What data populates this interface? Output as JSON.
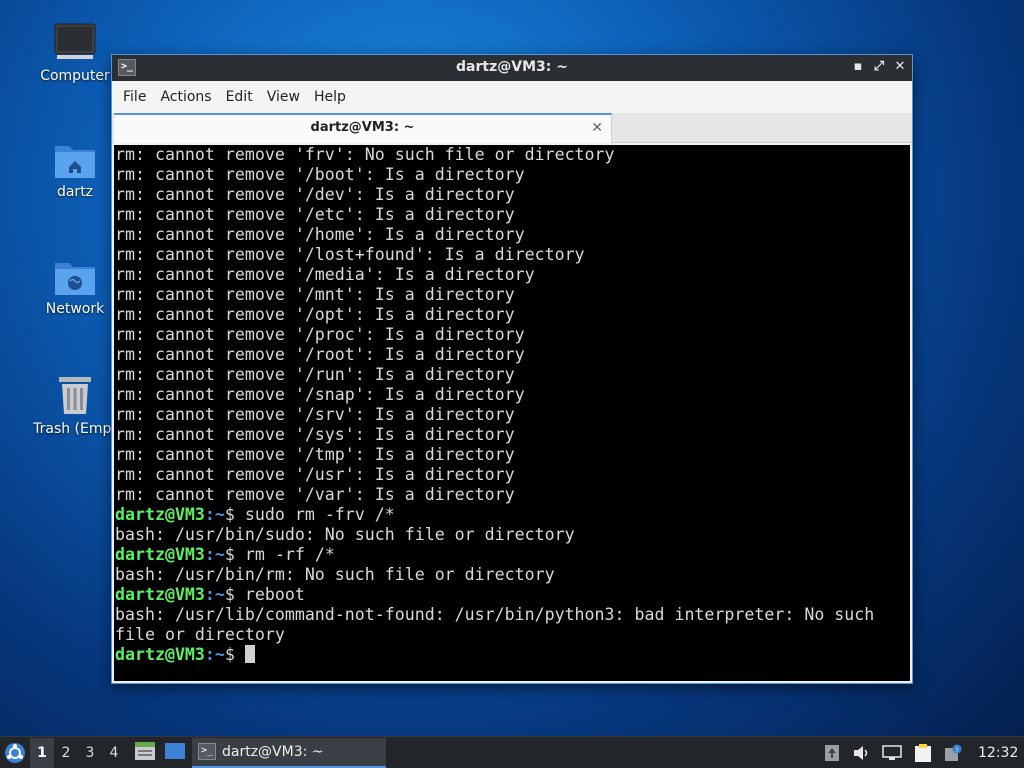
{
  "desktop": {
    "icons": [
      {
        "label": "Computer",
        "icon": "computer-icon"
      },
      {
        "label": "dartz",
        "icon": "home-folder-icon"
      },
      {
        "label": "Network",
        "icon": "network-folder-icon"
      },
      {
        "label": "Trash (Empt",
        "icon": "trash-icon"
      }
    ]
  },
  "window": {
    "title": "dartz@VM3: ~",
    "buttons": {
      "minimize": "▪",
      "maximize": "⤢",
      "close": "✕"
    },
    "menu": [
      "File",
      "Actions",
      "Edit",
      "View",
      "Help"
    ],
    "tab": {
      "label": "dartz@VM3: ~",
      "close": "✕"
    }
  },
  "terminal": {
    "lines": [
      {
        "type": "out",
        "text": "rm: cannot remove 'frv': No such file or directory"
      },
      {
        "type": "out",
        "text": "rm: cannot remove '/boot': Is a directory"
      },
      {
        "type": "out",
        "text": "rm: cannot remove '/dev': Is a directory"
      },
      {
        "type": "out",
        "text": "rm: cannot remove '/etc': Is a directory"
      },
      {
        "type": "out",
        "text": "rm: cannot remove '/home': Is a directory"
      },
      {
        "type": "out",
        "text": "rm: cannot remove '/lost+found': Is a directory"
      },
      {
        "type": "out",
        "text": "rm: cannot remove '/media': Is a directory"
      },
      {
        "type": "out",
        "text": "rm: cannot remove '/mnt': Is a directory"
      },
      {
        "type": "out",
        "text": "rm: cannot remove '/opt': Is a directory"
      },
      {
        "type": "out",
        "text": "rm: cannot remove '/proc': Is a directory"
      },
      {
        "type": "out",
        "text": "rm: cannot remove '/root': Is a directory"
      },
      {
        "type": "out",
        "text": "rm: cannot remove '/run': Is a directory"
      },
      {
        "type": "out",
        "text": "rm: cannot remove '/snap': Is a directory"
      },
      {
        "type": "out",
        "text": "rm: cannot remove '/srv': Is a directory"
      },
      {
        "type": "out",
        "text": "rm: cannot remove '/sys': Is a directory"
      },
      {
        "type": "out",
        "text": "rm: cannot remove '/tmp': Is a directory"
      },
      {
        "type": "out",
        "text": "rm: cannot remove '/usr': Is a directory"
      },
      {
        "type": "out",
        "text": "rm: cannot remove '/var': Is a directory"
      },
      {
        "type": "cmd",
        "user": "dartz@VM3",
        "path": ":~",
        "sym": "$ ",
        "text": "sudo rm -frv /*"
      },
      {
        "type": "out",
        "text": "bash: /usr/bin/sudo: No such file or directory"
      },
      {
        "type": "cmd",
        "user": "dartz@VM3",
        "path": ":~",
        "sym": "$ ",
        "text": "rm -rf /*"
      },
      {
        "type": "out",
        "text": "bash: /usr/bin/rm: No such file or directory"
      },
      {
        "type": "cmd",
        "user": "dartz@VM3",
        "path": ":~",
        "sym": "$ ",
        "text": "reboot"
      },
      {
        "type": "out",
        "text": "bash: /usr/lib/command-not-found: /usr/bin/python3: bad interpreter: No such\nfile or directory"
      },
      {
        "type": "cmd",
        "user": "dartz@VM3",
        "path": ":~",
        "sym": "$ ",
        "text": "",
        "cursor": true
      }
    ]
  },
  "taskbar": {
    "workspaces": [
      "1",
      "2",
      "3",
      "4"
    ],
    "active_workspace": "1",
    "task_label": "dartz@VM3: ~",
    "clock": "12:32"
  },
  "colors": {
    "accent": "#5294e2",
    "prompt_user": "#5ef05e",
    "terminal_bg": "#000000",
    "terminal_fg": "#d8d8d8"
  }
}
